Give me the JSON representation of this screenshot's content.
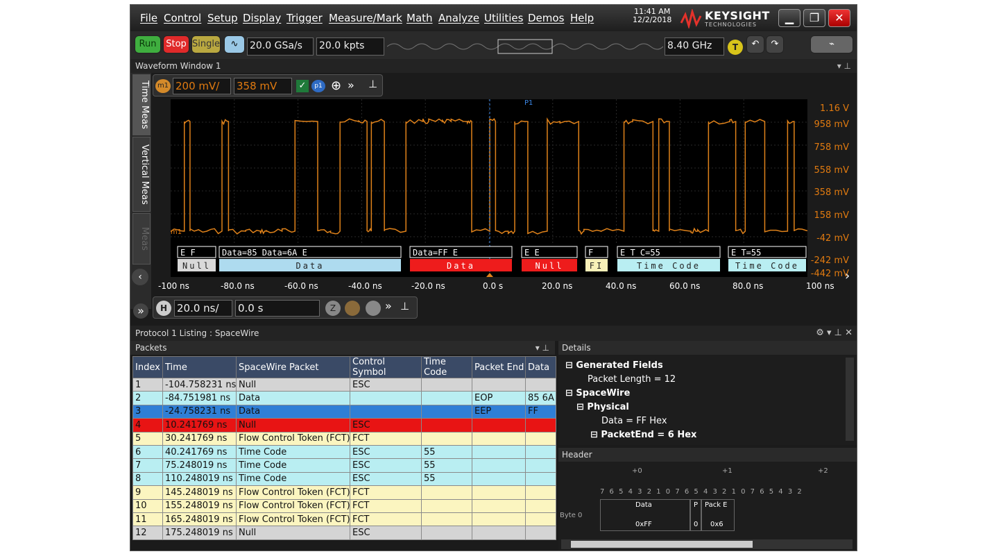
{
  "menu": [
    "File",
    "Control",
    "Setup",
    "Display",
    "Trigger",
    "Measure/Mark",
    "Math",
    "Analyze",
    "Utilities",
    "Demos",
    "Help"
  ],
  "clock": {
    "time": "11:41 AM",
    "date": "12/2/2018"
  },
  "brand": {
    "name": "KEYSIGHT",
    "sub": "TECHNOLOGIES"
  },
  "toolbar": {
    "run": "Run",
    "stop": "Stop",
    "single": "Single",
    "sample_rate": "20.0 GSa/s",
    "points": "20.0 kpts",
    "bandwidth": "8.40 GHz",
    "trigger_badge": "T"
  },
  "waveform_window": {
    "title": "Waveform Window 1",
    "tabs": [
      "Time Meas",
      "Vertical Meas",
      "Meas"
    ],
    "channel_badge": "m1",
    "vscale": "200 mV/",
    "voffset": "358 mV",
    "marker_badge": "p1",
    "marker_label": "P1",
    "ground_label": "m1",
    "y_labels": [
      "1.16 V",
      "958 mV",
      "758 mV",
      "558 mV",
      "358 mV",
      "158 mV",
      "-42 mV",
      "-242 mV",
      "-442 mV"
    ],
    "t_labels": [
      "-100 ns",
      "-80.0 ns",
      "-60.0 ns",
      "-40.0 ns",
      "-20.0 ns",
      "0.0 s",
      "20.0 ns",
      "40.0 ns",
      "60.0 ns",
      "80.0 ns",
      "100 ns"
    ],
    "timebase_badge": "H",
    "timebase": "20.0 ns/",
    "delay": "0.0 s"
  },
  "decode": [
    {
      "top": "E  F",
      "bottom": "Null",
      "color": "#d9d9d9"
    },
    {
      "top": "Data=85   Data=6A   E",
      "bottom": "Data",
      "color": "#aedbef"
    },
    {
      "top": "Data=FF   E",
      "bottom": "Data",
      "color": "#ee1c1c"
    },
    {
      "top": "E   E",
      "bottom": "Null",
      "color": "#ee1c1c"
    },
    {
      "top": "F",
      "bottom": "FI",
      "color": "#f8f0b8"
    },
    {
      "top": "E   T_C=55",
      "bottom": "Time Code",
      "color": "#b9eef2"
    },
    {
      "top": "E   T=55",
      "bottom": "Time Code",
      "color": "#b9eef2"
    }
  ],
  "listing": {
    "title": "Protocol 1 Listing : SpaceWire",
    "packets_label": "Packets",
    "columns": [
      "Index",
      "Time",
      "SpaceWire Packet",
      "Control Symbol",
      "Time Code",
      "Packet End",
      "Data"
    ],
    "rows": [
      {
        "c": "gray",
        "v": [
          "1",
          "-104.758231 ns",
          "Null",
          "ESC",
          "",
          "",
          ""
        ]
      },
      {
        "c": "cyan",
        "v": [
          "2",
          "-84.751981 ns",
          "Data",
          "",
          "",
          "EOP",
          "85 6A"
        ]
      },
      {
        "c": "blue",
        "v": [
          "3",
          "-24.758231 ns",
          "Data",
          "",
          "",
          "EEP",
          "FF"
        ]
      },
      {
        "c": "red",
        "v": [
          "4",
          "10.241769 ns",
          "Null",
          "ESC",
          "",
          "",
          ""
        ]
      },
      {
        "c": "yellow",
        "v": [
          "5",
          "30.241769 ns",
          "Flow Control Token (FCT)",
          "FCT",
          "",
          "",
          ""
        ]
      },
      {
        "c": "cyan",
        "v": [
          "6",
          "40.241769 ns",
          "Time Code",
          "ESC",
          "55",
          "",
          ""
        ]
      },
      {
        "c": "cyan",
        "v": [
          "7",
          "75.248019 ns",
          "Time Code",
          "ESC",
          "55",
          "",
          ""
        ]
      },
      {
        "c": "cyan",
        "v": [
          "8",
          "110.248019 ns",
          "Time Code",
          "ESC",
          "55",
          "",
          ""
        ]
      },
      {
        "c": "yellow",
        "v": [
          "9",
          "145.248019 ns",
          "Flow Control Token (FCT)",
          "FCT",
          "",
          "",
          ""
        ]
      },
      {
        "c": "yellow",
        "v": [
          "10",
          "155.248019 ns",
          "Flow Control Token (FCT)",
          "FCT",
          "",
          "",
          ""
        ]
      },
      {
        "c": "yellow",
        "v": [
          "11",
          "165.248019 ns",
          "Flow Control Token (FCT)",
          "FCT",
          "",
          "",
          ""
        ]
      },
      {
        "c": "gray",
        "v": [
          "12",
          "175.248019 ns",
          "Null",
          "ESC",
          "",
          "",
          ""
        ]
      }
    ]
  },
  "details": {
    "title": "Details",
    "items": [
      "Generated Fields",
      "Packet Length = 12",
      "SpaceWire",
      "Physical",
      "Data = FF Hex",
      "PacketEnd = 6 Hex"
    ]
  },
  "header_pane": {
    "title": "Header",
    "offsets": [
      "+0",
      "+1",
      "+2"
    ],
    "bits": "7 6 5 4 3 2 1 0 7 6 5 4 3 2 1 0 7 6 5 4 3 2",
    "byte_label": "Byte 0",
    "fields": [
      {
        "name": "Data",
        "value": "0xFF"
      },
      {
        "name": "P",
        "value": "0"
      },
      {
        "name": "Pack E",
        "value": "0x6"
      }
    ]
  }
}
